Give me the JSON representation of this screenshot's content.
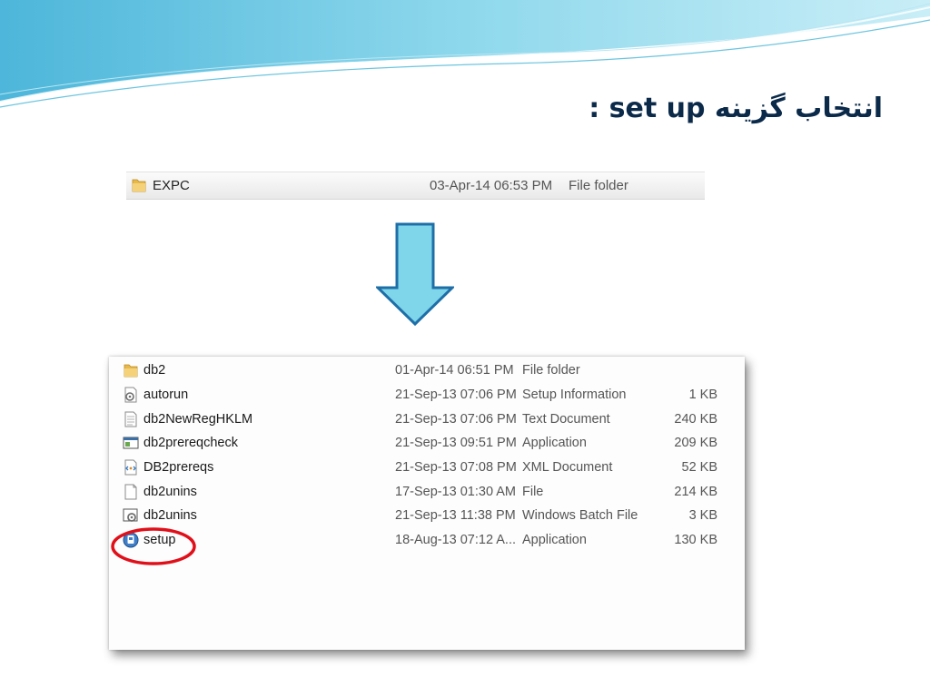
{
  "slide": {
    "title": "انتخاب گزینه set up :"
  },
  "top_folder": {
    "name": "EXPC",
    "date": "03-Apr-14 06:53 PM",
    "type": "File folder",
    "icon": "folder-icon"
  },
  "arrow": {
    "icon": "down-arrow-icon",
    "color": "#7fd6ea"
  },
  "files": [
    {
      "name": "db2",
      "date": "01-Apr-14 06:51 PM",
      "type": "File folder",
      "size": "",
      "icon": "folder-icon"
    },
    {
      "name": "autorun",
      "date": "21-Sep-13 07:06 PM",
      "type": "Setup Information",
      "size": "1 KB",
      "icon": "setup-info-icon"
    },
    {
      "name": "db2NewRegHKLM",
      "date": "21-Sep-13 07:06 PM",
      "type": "Text Document",
      "size": "240 KB",
      "icon": "text-document-icon"
    },
    {
      "name": "db2prereqcheck",
      "date": "21-Sep-13 09:51 PM",
      "type": "Application",
      "size": "209 KB",
      "icon": "application-icon"
    },
    {
      "name": "DB2prereqs",
      "date": "21-Sep-13 07:08 PM",
      "type": "XML Document",
      "size": "52 KB",
      "icon": "xml-document-icon"
    },
    {
      "name": "db2unins",
      "date": "17-Sep-13 01:30 AM",
      "type": "File",
      "size": "214 KB",
      "icon": "file-icon"
    },
    {
      "name": "db2unins",
      "date": "21-Sep-13 11:38 PM",
      "type": "Windows Batch File",
      "size": "3 KB",
      "icon": "batch-file-icon"
    },
    {
      "name": "setup",
      "date": "18-Aug-13 07:12 A...",
      "type": "Application",
      "size": "130 KB",
      "icon": "setup-app-icon"
    }
  ],
  "highlight": {
    "target": "setup",
    "color": "#e0101a"
  },
  "colors": {
    "title": "#0b2a4a",
    "wave": "#5fc4e0",
    "arrow_fill": "#7fd6ea",
    "arrow_stroke": "#1e6fa8"
  }
}
